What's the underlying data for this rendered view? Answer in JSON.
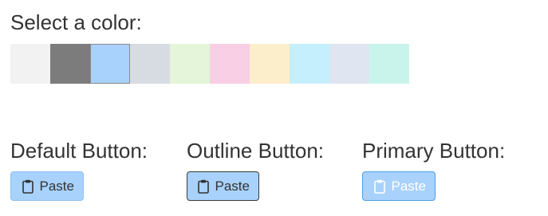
{
  "title": "Select a color:",
  "swatches": [
    {
      "color": "#f2f2f2",
      "name": "swatch-light-gray"
    },
    {
      "color": "#7c7c7c",
      "name": "swatch-dark-gray"
    },
    {
      "color": "#a8d2fb",
      "name": "swatch-light-blue",
      "selected": true
    },
    {
      "color": "#d7dce3",
      "name": "swatch-blue-gray"
    },
    {
      "color": "#e5f5d9",
      "name": "swatch-light-green"
    },
    {
      "color": "#f8cfe5",
      "name": "swatch-pink"
    },
    {
      "color": "#fdeecb",
      "name": "swatch-cream"
    },
    {
      "color": "#c5effc",
      "name": "swatch-cyan"
    },
    {
      "color": "#dfe5f1",
      "name": "swatch-lavender"
    },
    {
      "color": "#c9f4ec",
      "name": "swatch-mint"
    }
  ],
  "sections": {
    "default": {
      "label": "Default Button:",
      "button": "Paste"
    },
    "outline": {
      "label": "Outline Button:",
      "button": "Paste"
    },
    "primary": {
      "label": "Primary Button:",
      "button": "Paste"
    }
  },
  "icons": {
    "paste": "clipboard-icon"
  },
  "colors": {
    "selected": "#a8d2fb",
    "text": "#333333"
  }
}
